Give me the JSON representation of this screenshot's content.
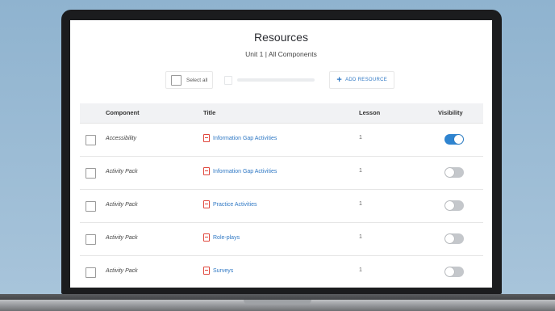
{
  "page": {
    "title": "Resources",
    "subtitle": "Unit 1 | All Components"
  },
  "toolbar": {
    "select_all_label": "Select all",
    "add_resource_label": "ADD RESOURCE"
  },
  "table": {
    "headers": {
      "component": "Component",
      "title": "Title",
      "lesson": "Lesson",
      "visibility": "Visibility"
    },
    "rows": [
      {
        "component": "Accessibility",
        "title": "Information Gap Activities",
        "lesson": "1",
        "visible": true
      },
      {
        "component": "Activity Pack",
        "title": "Information Gap Activities",
        "lesson": "1",
        "visible": false
      },
      {
        "component": "Activity Pack",
        "title": "Practice Activities",
        "lesson": "1",
        "visible": false
      },
      {
        "component": "Activity Pack",
        "title": "Role-plays",
        "lesson": "1",
        "visible": false
      },
      {
        "component": "Activity Pack",
        "title": "Surveys",
        "lesson": "1",
        "visible": false
      }
    ]
  },
  "colors": {
    "accent": "#2f78c4",
    "toggle_on": "#2f84d0",
    "pdf_icon": "#e0463c"
  },
  "icons": {
    "add": "plus-icon",
    "file": "pdf-file-icon"
  }
}
